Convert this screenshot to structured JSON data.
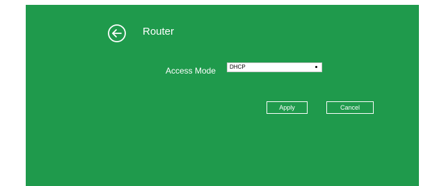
{
  "header": {
    "title": "Router",
    "back_icon": "back-arrow-circle-icon"
  },
  "form": {
    "access_mode_label": "Access Mode",
    "access_mode_value": "DHCP"
  },
  "actions": {
    "apply_label": "Apply",
    "cancel_label": "Cancel"
  },
  "colors": {
    "background": "#1f9a4c",
    "text": "#ffffff",
    "page_margin": "#ffffff"
  }
}
